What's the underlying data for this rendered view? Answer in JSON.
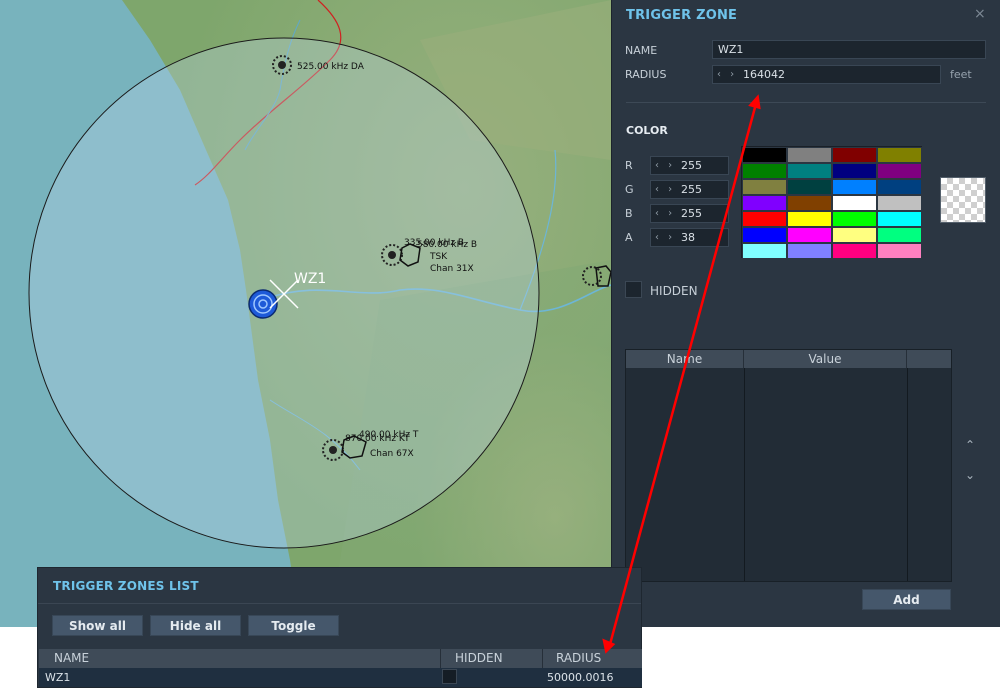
{
  "map": {
    "zone_label": "WZ1",
    "beacon_ndb_da": "525.00 kHz DA",
    "beacon_b_freq_a": "335.00 kHz B",
    "beacon_b_freq_b": "580.00 kHz B",
    "beacon_b_tacan_id": "TSK",
    "beacon_b_tacan_chan": "Chan 31X",
    "beacon_t_freq_a": "490.00 kHz T",
    "beacon_t_freq_b": "870.00 kHz KT",
    "beacon_t_tacan_chan": "Chan 67X"
  },
  "trigger_zone": {
    "title": "TRIGGER ZONE",
    "close_glyph": "×",
    "name_label": "NAME",
    "name_value": "WZ1",
    "radius_label": "RADIUS",
    "radius_value": "164042",
    "radius_unit": "feet",
    "color_heading": "COLOR",
    "channels": [
      {
        "label": "R",
        "value": "255"
      },
      {
        "label": "G",
        "value": "255"
      },
      {
        "label": "B",
        "value": "255"
      },
      {
        "label": "A",
        "value": "38"
      }
    ],
    "palette": [
      "#000000",
      "#808080",
      "#800000",
      "#808000",
      "#008000",
      "#008080",
      "#000080",
      "#800080",
      "#808040",
      "#004040",
      "#0080ff",
      "#004080",
      "#8000ff",
      "#804000",
      "#ffffff",
      "#c0c0c0",
      "#ff0000",
      "#ffff00",
      "#00ff00",
      "#00ffff",
      "#0000ff",
      "#ff00ff",
      "#ffff80",
      "#00ff80",
      "#80ffff",
      "#8080ff",
      "#ff0080",
      "#ff80c0"
    ],
    "hidden_label": "HIDDEN",
    "table_headers": [
      "Name",
      "Value"
    ],
    "add_label": "Add",
    "up_glyph": "⌃",
    "down_glyph": "⌄"
  },
  "zones_list": {
    "title": "TRIGGER ZONES LIST",
    "buttons": [
      "Show all",
      "Hide all",
      "Toggle"
    ],
    "columns": [
      "NAME",
      "HIDDEN",
      "RADIUS"
    ],
    "rows": [
      {
        "name": "WZ1",
        "radius": "50000.0016"
      }
    ]
  },
  "colors": {
    "accent": "#6fc3ea",
    "panel_bg": "#2b3642",
    "annotation_arrow": "#ff0000"
  }
}
